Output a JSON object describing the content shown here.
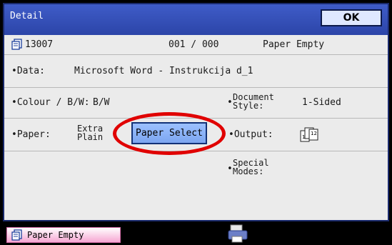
{
  "header": {
    "title": "Detail",
    "ok_label": "OK"
  },
  "job": {
    "number": "13007",
    "pages": "001 / 000",
    "status": "Paper Empty"
  },
  "data_row": {
    "label": "•Data:",
    "value": "Microsoft Word - Instrukcija d_1"
  },
  "colour_row": {
    "label": "•Colour / B/W:",
    "value": "B/W"
  },
  "document_style": {
    "label_line1": "Document",
    "label_line2": "Style:",
    "value": "1-Sided"
  },
  "paper_row": {
    "label": "•Paper:",
    "value_line1": "Extra",
    "value_line2": "Plain",
    "button_label": "Paper Select"
  },
  "output": {
    "label": "•Output:",
    "icon": "collate-output-icon"
  },
  "special_modes": {
    "label_line1": "Special",
    "label_line2": "Modes:"
  },
  "status_bar": {
    "text": "Paper Empty",
    "icon": "job-document-icon"
  },
  "colors": {
    "title_bar": "#3352b9",
    "button_fill": "#8ab2f8",
    "highlight": "#e00000",
    "status_pink": "#f6a6d2"
  }
}
